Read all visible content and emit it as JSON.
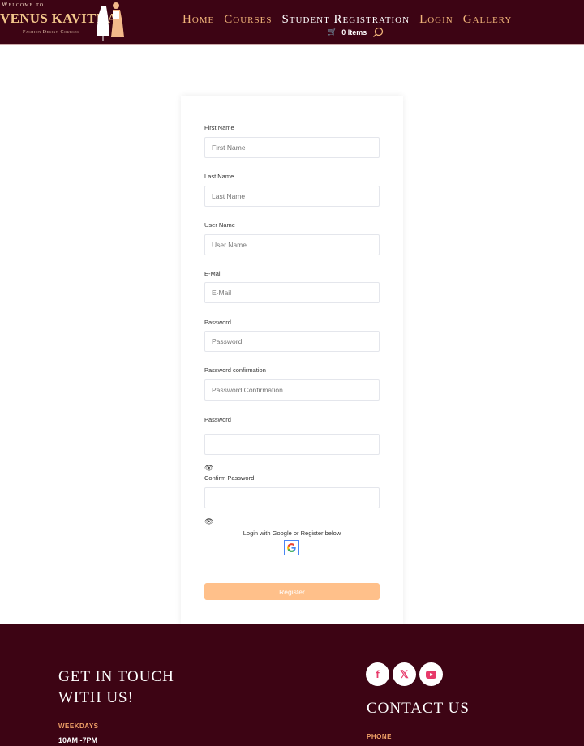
{
  "header": {
    "logo": {
      "welcome": "Welcome to",
      "brand": "VENUS KAVITHA",
      "tagline": "Fashion Design Courses"
    },
    "nav": [
      {
        "label": "Home",
        "active": false
      },
      {
        "label": "Courses",
        "active": false
      },
      {
        "label": "Student Registration",
        "active": true
      },
      {
        "label": "Login",
        "active": false
      },
      {
        "label": "Gallery",
        "active": false
      }
    ],
    "cart": {
      "icon": "cart-icon",
      "label": "0 Items"
    },
    "search_icon": "search-icon"
  },
  "form": {
    "fields": [
      {
        "label": "First Name",
        "placeholder": "First Name"
      },
      {
        "label": "Last Name",
        "placeholder": "Last Name"
      },
      {
        "label": "User Name",
        "placeholder": "User Name"
      },
      {
        "label": "E-Mail",
        "placeholder": "E-Mail"
      },
      {
        "label": "Password",
        "placeholder": "Password"
      },
      {
        "label": "Password confirmation",
        "placeholder": "Password Confirmation"
      },
      {
        "label": "Password",
        "placeholder": ""
      },
      {
        "label": "Confirm Password",
        "placeholder": ""
      }
    ],
    "google_note": "Login with Google or Register below",
    "register_label": "Register"
  },
  "footer": {
    "get_in_touch_line1": "GET IN TOUCH",
    "get_in_touch_line2": "WITH US!",
    "weekdays_label": "WEEKDAYS",
    "weekdays_hours": "10AM -7PM",
    "contact_title": "CONTACT US",
    "phone_label": "PHONE",
    "social": [
      "facebook",
      "x",
      "youtube"
    ]
  },
  "colors": {
    "brand": "#3d0414",
    "accent": "#f1b57a",
    "button": "#ffc08a"
  }
}
